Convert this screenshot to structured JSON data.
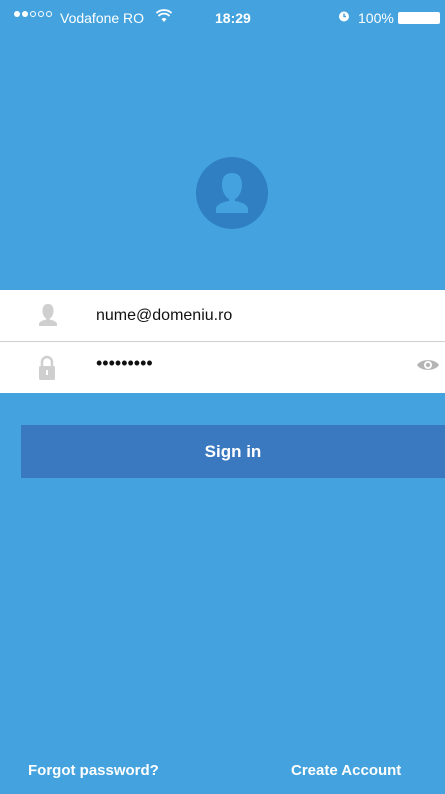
{
  "status_bar": {
    "carrier": "Vodafone RO",
    "time": "18:29",
    "battery": "100%",
    "signal_bars_filled": 2,
    "signal_bars_total": 5
  },
  "login": {
    "email_value": "nume@domeniu.ro",
    "password_value": "•••••••••",
    "signin_label": "Sign in",
    "forgot_label": "Forgot password?",
    "create_label": "Create Account"
  },
  "colors": {
    "background": "#44a3de",
    "button": "#3a79c0",
    "avatar_circle": "#2f7fc2",
    "form_background": "#ffffff"
  },
  "icons": {
    "user": "user-icon",
    "lock": "lock-icon",
    "eye": "eye-icon",
    "wifi": "wifi-icon",
    "alarm": "alarm-icon",
    "battery": "battery-icon"
  }
}
